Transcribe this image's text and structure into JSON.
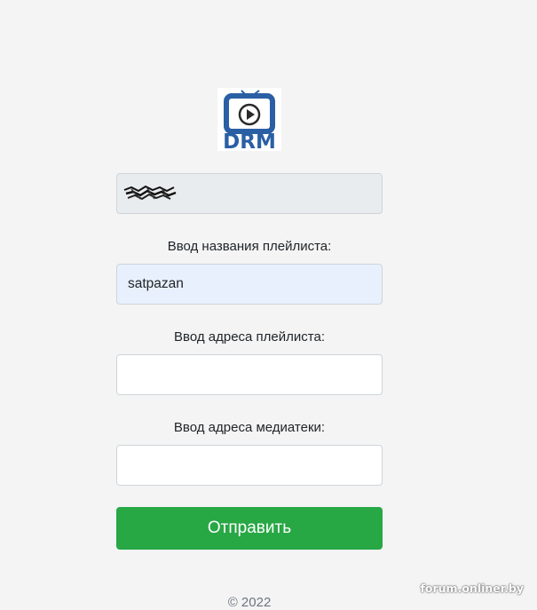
{
  "logo": {
    "text": "DRM",
    "brand_color": "#2a5fa4",
    "icon": "tv-play-icon"
  },
  "form": {
    "readonly_field": {
      "state": "redacted-scribble"
    },
    "playlist_name": {
      "label": "Ввод названия плейлиста:",
      "value": "satpazan"
    },
    "playlist_address": {
      "label": "Ввод адреса плейлиста:",
      "value": ""
    },
    "media_address": {
      "label": "Ввод адреса медиатеки:",
      "value": ""
    },
    "submit_label": "Отправить",
    "submit_color": "#28a745"
  },
  "footer": {
    "copyright": "© 2022"
  },
  "watermark": {
    "text": "forum.onliner.by"
  }
}
